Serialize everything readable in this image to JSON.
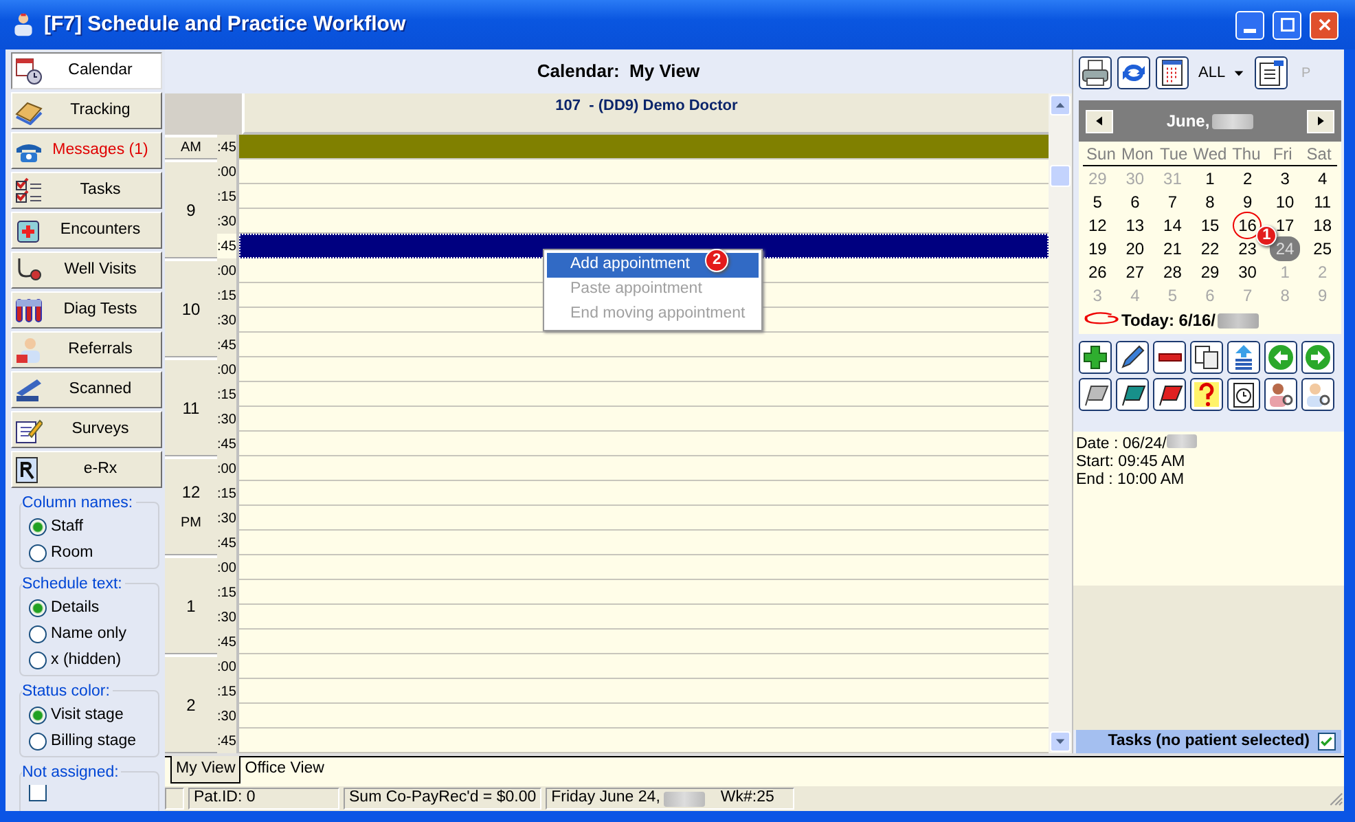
{
  "window": {
    "title": "[F7] Schedule and Practice Workflow"
  },
  "sidebar": {
    "items": [
      {
        "label": "Calendar",
        "selected": true,
        "unread": false
      },
      {
        "label": "Tracking",
        "selected": false,
        "unread": false
      },
      {
        "label": "Messages (1)",
        "selected": false,
        "unread": true
      },
      {
        "label": "Tasks",
        "selected": false,
        "unread": false
      },
      {
        "label": "Encounters",
        "selected": false,
        "unread": false
      },
      {
        "label": "Well Visits",
        "selected": false,
        "unread": false
      },
      {
        "label": "Diag Tests",
        "selected": false,
        "unread": false
      },
      {
        "label": "Referrals",
        "selected": false,
        "unread": false
      },
      {
        "label": "Scanned",
        "selected": false,
        "unread": false
      },
      {
        "label": "Surveys",
        "selected": false,
        "unread": false
      },
      {
        "label": "e-Rx",
        "selected": false,
        "unread": false
      }
    ],
    "option_groups": [
      {
        "title": "Column names:",
        "options": [
          {
            "label": "Staff",
            "selected": true
          },
          {
            "label": "Room",
            "selected": false
          }
        ]
      },
      {
        "title": "Schedule text:",
        "options": [
          {
            "label": "Details",
            "selected": true
          },
          {
            "label": "Name only",
            "selected": false
          },
          {
            "label": "x (hidden)",
            "selected": false
          }
        ]
      },
      {
        "title": "Status color:",
        "options": [
          {
            "label": "Visit stage",
            "selected": true
          },
          {
            "label": "Billing stage",
            "selected": false
          }
        ]
      },
      {
        "title": "Not assigned:",
        "checkbox": {
          "checked": false
        }
      }
    ]
  },
  "schedule": {
    "title": "Calendar:  My View",
    "column": "107  - (DD9) Demo Doctor",
    "hours": [
      {
        "meridiem": "AM",
        "slots": [
          {
            "minute": ":45",
            "kind": "blocked",
            "selected": false
          }
        ]
      },
      {
        "label": "9",
        "slots": [
          {
            "minute": ":00",
            "kind": "open",
            "selected": false
          },
          {
            "minute": ":15",
            "kind": "open",
            "selected": false
          },
          {
            "minute": ":30",
            "kind": "open",
            "selected": false
          },
          {
            "minute": ":45",
            "kind": "open",
            "selected": true
          }
        ]
      },
      {
        "label": "10",
        "slots": [
          {
            "minute": ":00",
            "kind": "open",
            "selected": false
          },
          {
            "minute": ":15",
            "kind": "open",
            "selected": false
          },
          {
            "minute": ":30",
            "kind": "open",
            "selected": false
          },
          {
            "minute": ":45",
            "kind": "open",
            "selected": false
          }
        ]
      },
      {
        "label": "11",
        "slots": [
          {
            "minute": ":00",
            "kind": "open",
            "selected": false
          },
          {
            "minute": ":15",
            "kind": "open",
            "selected": false
          },
          {
            "minute": ":30",
            "kind": "open",
            "selected": false
          },
          {
            "minute": ":45",
            "kind": "open",
            "selected": false
          }
        ]
      },
      {
        "label": "12",
        "meridiem": "PM",
        "slots": [
          {
            "minute": ":00",
            "kind": "open",
            "selected": false
          },
          {
            "minute": ":15",
            "kind": "open",
            "selected": false
          },
          {
            "minute": ":30",
            "kind": "open",
            "selected": false
          },
          {
            "minute": ":45",
            "kind": "open",
            "selected": false
          }
        ]
      },
      {
        "label": "1",
        "slots": [
          {
            "minute": ":00",
            "kind": "open",
            "selected": false
          },
          {
            "minute": ":15",
            "kind": "open",
            "selected": false
          },
          {
            "minute": ":30",
            "kind": "open",
            "selected": false
          },
          {
            "minute": ":45",
            "kind": "open",
            "selected": false
          }
        ]
      },
      {
        "label": "2",
        "slots": [
          {
            "minute": ":00",
            "kind": "open",
            "selected": false
          },
          {
            "minute": ":15",
            "kind": "open",
            "selected": false
          },
          {
            "minute": ":30",
            "kind": "open",
            "selected": false
          },
          {
            "minute": ":45",
            "kind": "open",
            "selected": false
          }
        ]
      }
    ],
    "context_menu": {
      "items": [
        {
          "label": "Add appointment",
          "selected": true,
          "disabled": false,
          "badge": "2"
        },
        {
          "label": "Paste appointment",
          "selected": false,
          "disabled": true
        },
        {
          "label": "End moving appointment",
          "selected": false,
          "disabled": true
        }
      ]
    },
    "tabs": [
      {
        "label": "My View",
        "selected": true
      },
      {
        "label": "Office View",
        "selected": false
      }
    ]
  },
  "toolbar": {
    "filter": "ALL",
    "extra": {
      "label": "P",
      "disabled": true
    }
  },
  "mini_calendar": {
    "month": "June,",
    "weekdays": [
      "Sun",
      "Mon",
      "Tue",
      "Wed",
      "Thu",
      "Fri",
      "Sat"
    ],
    "badge": "1",
    "weeks": [
      [
        {
          "day": "29",
          "kind": "other",
          "selected": false,
          "circled": false
        },
        {
          "day": "30",
          "kind": "other",
          "selected": false,
          "circled": false
        },
        {
          "day": "31",
          "kind": "other",
          "selected": false,
          "circled": false
        },
        {
          "day": "1",
          "kind": "current",
          "selected": false,
          "circled": false
        },
        {
          "day": "2",
          "kind": "current",
          "selected": false,
          "circled": false
        },
        {
          "day": "3",
          "kind": "current",
          "selected": false,
          "circled": false
        },
        {
          "day": "4",
          "kind": "current",
          "selected": false,
          "circled": false
        }
      ],
      [
        {
          "day": "5",
          "kind": "current",
          "selected": false,
          "circled": false
        },
        {
          "day": "6",
          "kind": "current",
          "selected": false,
          "circled": false
        },
        {
          "day": "7",
          "kind": "current",
          "selected": false,
          "circled": false
        },
        {
          "day": "8",
          "kind": "current",
          "selected": false,
          "circled": false
        },
        {
          "day": "9",
          "kind": "current",
          "selected": false,
          "circled": false
        },
        {
          "day": "10",
          "kind": "current",
          "selected": false,
          "circled": false
        },
        {
          "day": "11",
          "kind": "current",
          "selected": false,
          "circled": false
        }
      ],
      [
        {
          "day": "12",
          "kind": "current",
          "selected": false,
          "circled": false
        },
        {
          "day": "13",
          "kind": "current",
          "selected": false,
          "circled": false
        },
        {
          "day": "14",
          "kind": "current",
          "selected": false,
          "circled": false
        },
        {
          "day": "15",
          "kind": "current",
          "selected": false,
          "circled": false
        },
        {
          "day": "16",
          "kind": "current",
          "selected": false,
          "circled": true
        },
        {
          "day": "17",
          "kind": "current",
          "selected": false,
          "circled": false
        },
        {
          "day": "18",
          "kind": "current",
          "selected": false,
          "circled": false
        }
      ],
      [
        {
          "day": "19",
          "kind": "current",
          "selected": false,
          "circled": false
        },
        {
          "day": "20",
          "kind": "current",
          "selected": false,
          "circled": false
        },
        {
          "day": "21",
          "kind": "current",
          "selected": false,
          "circled": false
        },
        {
          "day": "22",
          "kind": "current",
          "selected": false,
          "circled": false
        },
        {
          "day": "23",
          "kind": "current",
          "selected": false,
          "circled": false
        },
        {
          "day": "24",
          "kind": "current",
          "selected": true,
          "circled": false
        },
        {
          "day": "25",
          "kind": "current",
          "selected": false,
          "circled": false
        }
      ],
      [
        {
          "day": "26",
          "kind": "current",
          "selected": false,
          "circled": false
        },
        {
          "day": "27",
          "kind": "current",
          "selected": false,
          "circled": false
        },
        {
          "day": "28",
          "kind": "current",
          "selected": false,
          "circled": false
        },
        {
          "day": "29",
          "kind": "current",
          "selected": false,
          "circled": false
        },
        {
          "day": "30",
          "kind": "current",
          "selected": false,
          "circled": false
        },
        {
          "day": "1",
          "kind": "other",
          "selected": false,
          "circled": false
        },
        {
          "day": "2",
          "kind": "other",
          "selected": false,
          "circled": false
        }
      ],
      [
        {
          "day": "3",
          "kind": "other",
          "selected": false,
          "circled": false
        },
        {
          "day": "4",
          "kind": "other",
          "selected": false,
          "circled": false
        },
        {
          "day": "5",
          "kind": "other",
          "selected": false,
          "circled": false
        },
        {
          "day": "6",
          "kind": "other",
          "selected": false,
          "circled": false
        },
        {
          "day": "7",
          "kind": "other",
          "selected": false,
          "circled": false
        },
        {
          "day": "8",
          "kind": "other",
          "selected": false,
          "circled": false
        },
        {
          "day": "9",
          "kind": "other",
          "selected": false,
          "circled": false
        }
      ]
    ],
    "today": {
      "label": "Today: 6/16/",
      "circled": true
    }
  },
  "details": [
    "Date : 06/24/",
    "Start: 09:45 AM",
    "End : 10:00 AM"
  ],
  "tasks_bar": {
    "label": "Tasks (no patient selected)",
    "checked": true
  },
  "status_bar": [
    "Pat.ID: 0",
    "Sum Co-PayRec'd = $0.00",
    "Friday  June 24,",
    "Wk#:25"
  ]
}
